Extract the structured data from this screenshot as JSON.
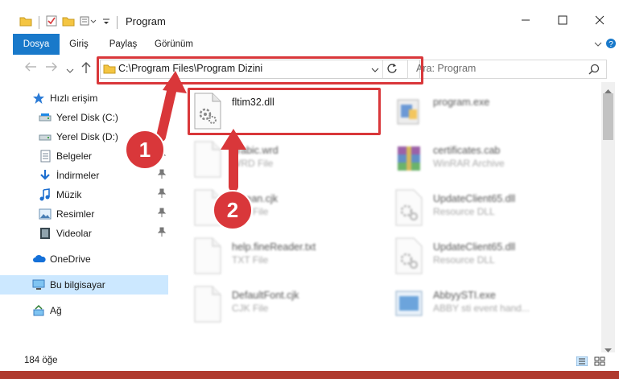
{
  "window": {
    "title": "Program"
  },
  "ribbon": {
    "tabs": [
      "Dosya",
      "Giriş",
      "Paylaş",
      "Görünüm"
    ]
  },
  "address": {
    "path": "C:\\Program Files\\Program Dizini"
  },
  "search": {
    "placeholder": "Ara: Program"
  },
  "sidebar": {
    "items": [
      {
        "label": "Hızlı erişim",
        "icon": "star-icon"
      },
      {
        "label": "Yerel Disk (C:)",
        "icon": "drive-icon"
      },
      {
        "label": "Yerel Disk (D:)",
        "icon": "drive-icon"
      },
      {
        "label": "Belgeler",
        "icon": "document-icon"
      },
      {
        "label": "İndirmeler",
        "icon": "download-icon"
      },
      {
        "label": "Müzik",
        "icon": "music-icon"
      },
      {
        "label": "Resimler",
        "icon": "picture-icon"
      },
      {
        "label": "Videolar",
        "icon": "video-icon"
      },
      {
        "label": "OneDrive",
        "icon": "cloud-icon"
      },
      {
        "label": "Bu bilgisayar",
        "icon": "computer-icon"
      },
      {
        "label": "Ağ",
        "icon": "network-icon"
      }
    ]
  },
  "files": [
    {
      "name": "fltim32.dll",
      "type": ""
    },
    {
      "name": "program.exe",
      "type": ""
    },
    {
      "name": "arabic.wrd",
      "type": "WRD File"
    },
    {
      "name": "certificates.cab",
      "type": "WinRAR Archive"
    },
    {
      "name": "korean.cjk",
      "type": "CJK File"
    },
    {
      "name": "UpdateClient65.dll",
      "type": "Resource DLL"
    },
    {
      "name": "help.fineReader.txt",
      "type": "TXT File"
    },
    {
      "name": "UpdateClient65.dll",
      "type": "Resource DLL"
    },
    {
      "name": "DefaultFont.cjk",
      "type": "CJK File"
    },
    {
      "name": "AbbyySTI.exe",
      "type": "ABBY sti event hand..."
    }
  ],
  "status": {
    "count": "184 öğe"
  },
  "annotations": {
    "badge1": "1",
    "badge2": "2"
  },
  "colors": {
    "accent": "#1979ca",
    "highlight": "#d9373a",
    "selected": "#cce8ff"
  }
}
